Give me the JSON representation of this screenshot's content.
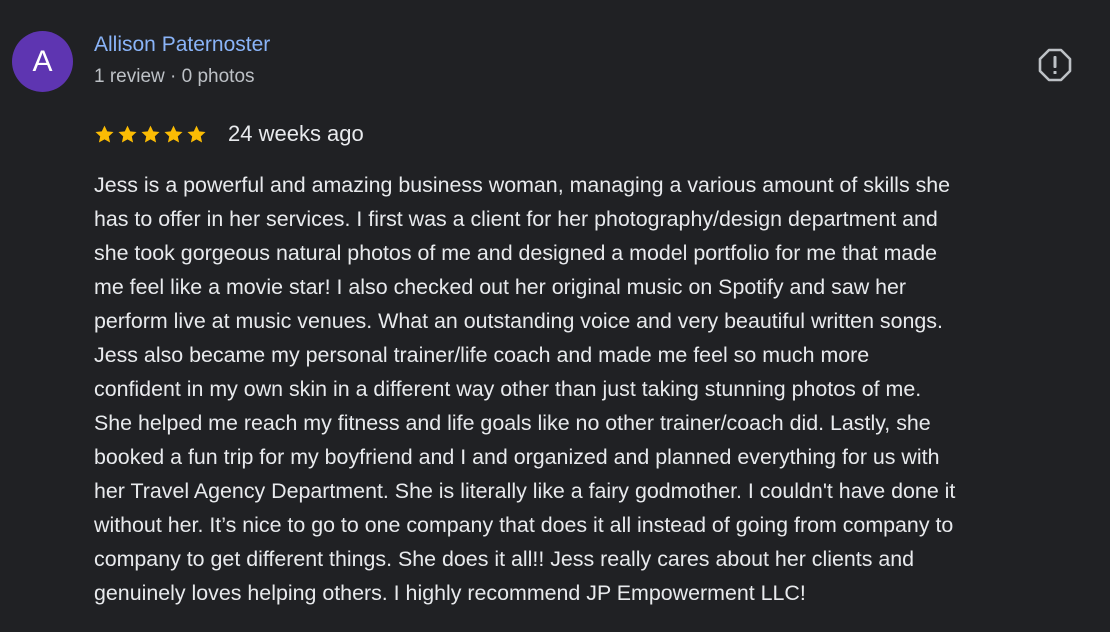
{
  "reviewer": {
    "avatar_letter": "A",
    "avatar_color": "#5e35b1",
    "name": "Allison Paternoster",
    "stats": "1 review · 0 photos"
  },
  "flag_icon": "report-flag-icon",
  "rating": {
    "stars": 5,
    "max_stars": 5,
    "star_color": "#fbbc04",
    "time_ago": "24 weeks ago"
  },
  "review_lines": [
    "Jess is a powerful and amazing business woman, managing a various amount of skills she",
    "has to offer in her services. I first was a client for her photography/design department and",
    "she took gorgeous natural photos of me and designed a model portfolio for me that made",
    "me feel like a movie star! I also checked out her original music on Spotify and saw her",
    "perform live at music venues. What an outstanding voice and very beautiful written songs.",
    "Jess also became my personal trainer/life coach and made me feel so much more",
    "confident in my own skin in a different way other than just taking stunning photos of me.",
    "She helped me reach my fitness and life goals like no other trainer/coach did. Lastly, she",
    "booked a fun trip for my boyfriend and I and organized and planned everything for us with",
    "her Travel Agency Department. She is literally like a fairy godmother. I couldn't have done it",
    "without her. It’s nice to go to one company that does it all instead of going from company to",
    "company to get different things. She does it all!! Jess really cares about her clients and",
    "genuinely loves helping others. I highly recommend JP Empowerment LLC!"
  ]
}
